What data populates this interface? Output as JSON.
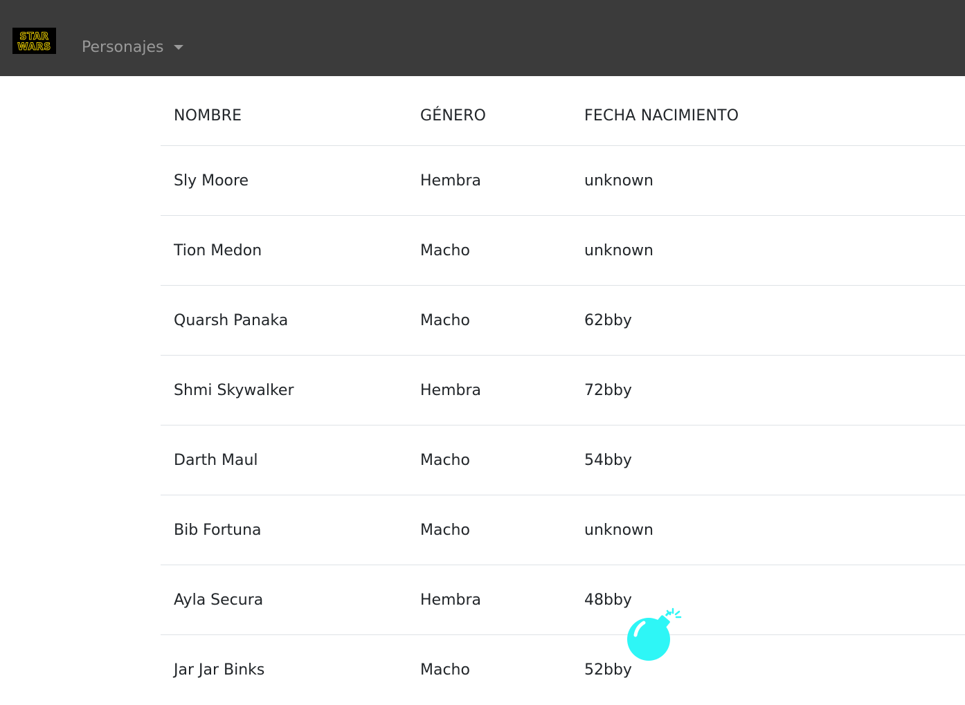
{
  "navbar": {
    "logo_text": "STAR WARS",
    "menu_label": "Personajes"
  },
  "table": {
    "headers": [
      "NOMBRE",
      "GÉNERO",
      "FECHA NACIMIENTO"
    ],
    "rows": [
      [
        "Sly Moore",
        "Hembra",
        "unknown"
      ],
      [
        "Tion Medon",
        "Macho",
        "unknown"
      ],
      [
        "Quarsh Panaka",
        "Macho",
        "62bby"
      ],
      [
        "Shmi Skywalker",
        "Hembra",
        "72bby"
      ],
      [
        "Darth Maul",
        "Macho",
        "54bby"
      ],
      [
        "Bib Fortuna",
        "Macho",
        "unknown"
      ],
      [
        "Ayla Secura",
        "Hembra",
        "48bby"
      ],
      [
        "Jar Jar Binks",
        "Macho",
        "52bby"
      ]
    ]
  },
  "colors": {
    "navbar_bg": "#3b3b3b",
    "nav_text": "#9a9a9a",
    "logo_yellow": "#e0c400",
    "bomb_cyan": "#2ef6f6"
  },
  "icons": {
    "caret": "caret-down-icon",
    "bomb": "bomb-icon"
  }
}
